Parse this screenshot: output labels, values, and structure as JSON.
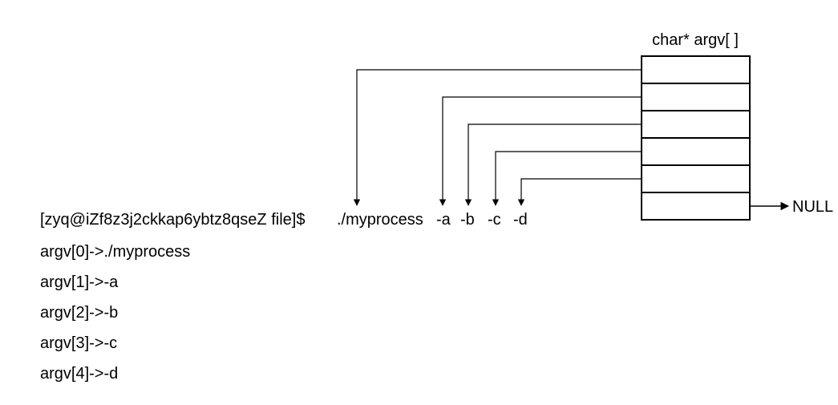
{
  "title": "char* argv[ ]",
  "null_label": "NULL",
  "prompt_full": "[zyq@iZf8z3j2ckkap6ybtz8qseZ file]$ ./myprocess -a -b -c -d",
  "prompt_prefix": "[zyq@iZf8z3j2ckkap6ybtz8qseZ file]$ ",
  "tokens": [
    "./myprocess",
    "-a",
    "-b",
    "-c",
    "-d"
  ],
  "argv_lines": [
    "argv[0]->./myprocess",
    "argv[1]->-a",
    "argv[2]->-b",
    "argv[3]->-c",
    "argv[4]->-d"
  ],
  "argv_count": 6
}
